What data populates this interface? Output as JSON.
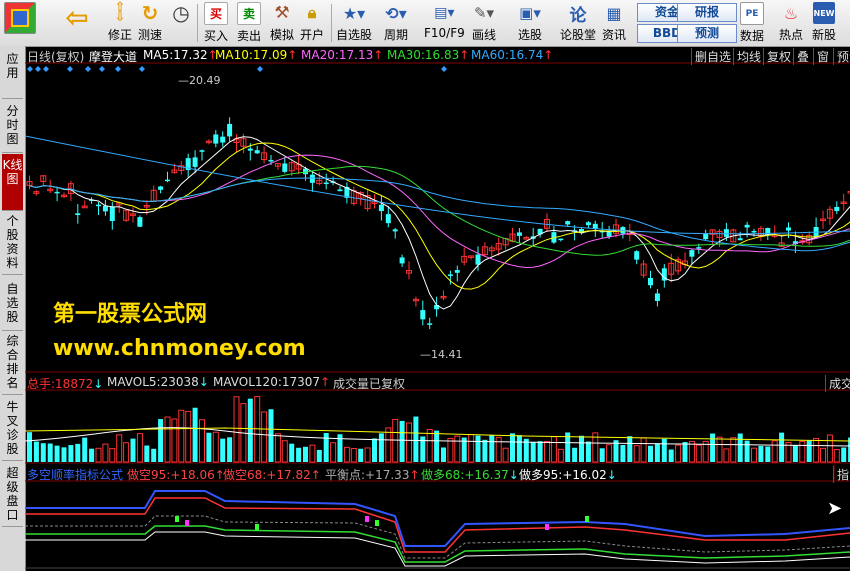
{
  "toolbar": {
    "buttons": [
      {
        "label": "",
        "icon": "windows-icon"
      },
      {
        "label": "",
        "icon": "back-arrow-icon"
      },
      {
        "label": "修正",
        "icon": "up-down-arrows-icon"
      },
      {
        "label": "测速",
        "icon": "refresh-icon"
      },
      {
        "label": "",
        "icon": "clock-icon"
      },
      {
        "label": "买入",
        "icon": "buy-icon",
        "glyph": "买"
      },
      {
        "label": "卖出",
        "icon": "sell-icon",
        "glyph": "卖"
      },
      {
        "label": "模拟",
        "icon": "hammer-icon"
      },
      {
        "label": "开户",
        "icon": "lock-icon"
      },
      {
        "label": "自选股",
        "icon": "star-icon"
      },
      {
        "label": "周期",
        "icon": "cycle-icon"
      },
      {
        "label": "F10/F9",
        "icon": "f10-icon"
      },
      {
        "label": "画线",
        "icon": "pencil-icon"
      },
      {
        "label": "选股",
        "icon": "screen-icon"
      },
      {
        "label": "论股堂",
        "icon": "forum-icon"
      },
      {
        "label": "资讯",
        "icon": "news-icon"
      },
      {
        "label": "数据",
        "icon": "pe-icon",
        "glyph": "PE"
      },
      {
        "label": "热点",
        "icon": "hot-icon"
      },
      {
        "label": "新股",
        "icon": "new-stock-icon",
        "glyph": "NEW"
      }
    ],
    "small_buttons": [
      "资金",
      "研报",
      "BBD",
      "预测"
    ]
  },
  "sidebar": [
    "应用",
    "分时图",
    "K线图",
    "个股资料",
    "自选股",
    "综合排名",
    "牛叉诊股",
    "超级盘口"
  ],
  "price_header": {
    "period": "日线(复权)",
    "stock": "摩登大道",
    "ma": [
      {
        "label": "MA5:",
        "value": "17.32",
        "arrow": "↑",
        "color": "#ffffff"
      },
      {
        "label": "MA10:",
        "value": "17.09",
        "arrow": "↑",
        "color": "#ffff00"
      },
      {
        "label": "MA20:",
        "value": "17.13",
        "arrow": "↑",
        "color": "#ff66ff"
      },
      {
        "label": "MA30:",
        "value": "16.83",
        "arrow": "↑",
        "color": "#33dd33"
      },
      {
        "label": "MA60:",
        "value": "16.74",
        "arrow": "↑",
        "color": "#33aaff"
      }
    ],
    "right_buttons": [
      "删自选",
      "均线",
      "复权",
      "叠",
      "窗",
      "预测"
    ]
  },
  "annotations": {
    "high": "20.49",
    "low": "14.41"
  },
  "watermark": {
    "line1": "第一股票公式网",
    "line2": "www.chnmoney.com"
  },
  "volume_header": {
    "total": {
      "label": "总手:",
      "value": "18872",
      "arrow": "↓"
    },
    "mavol5": {
      "label": "MAVOL5:",
      "value": "23038",
      "arrow": "↓"
    },
    "mavol120": {
      "label": "MAVOL120:",
      "value": "17307",
      "arrow": "↑"
    },
    "note": "成交量已复权",
    "right": "成交"
  },
  "indicator_header": {
    "name": "多空顺率指标公式",
    "items": [
      {
        "label": "做空95:",
        "value": "+18.06",
        "arrow": "↑",
        "color": "#ff4444"
      },
      {
        "label": "做空68:",
        "value": "+17.82",
        "arrow": "↑",
        "color": "#ff4444"
      },
      {
        "label": "平衡点:",
        "value": "+17.33",
        "arrow": "↑",
        "color": "#aaaaaa"
      },
      {
        "label": "做多68:",
        "value": "+16.37",
        "arrow": "↓",
        "color": "#33dd33"
      },
      {
        "label": "做多95:",
        "value": "+16.02",
        "arrow": "↓",
        "color": "#ffffff"
      }
    ],
    "right": "指"
  },
  "colors": {
    "up": "#ff3333",
    "down": "#33ffff",
    "ma5": "#ffffff",
    "ma10": "#ffff00",
    "ma20": "#ff66ff",
    "ma30": "#33dd33",
    "ma60": "#33aaff",
    "signal": "#3399ff"
  }
}
